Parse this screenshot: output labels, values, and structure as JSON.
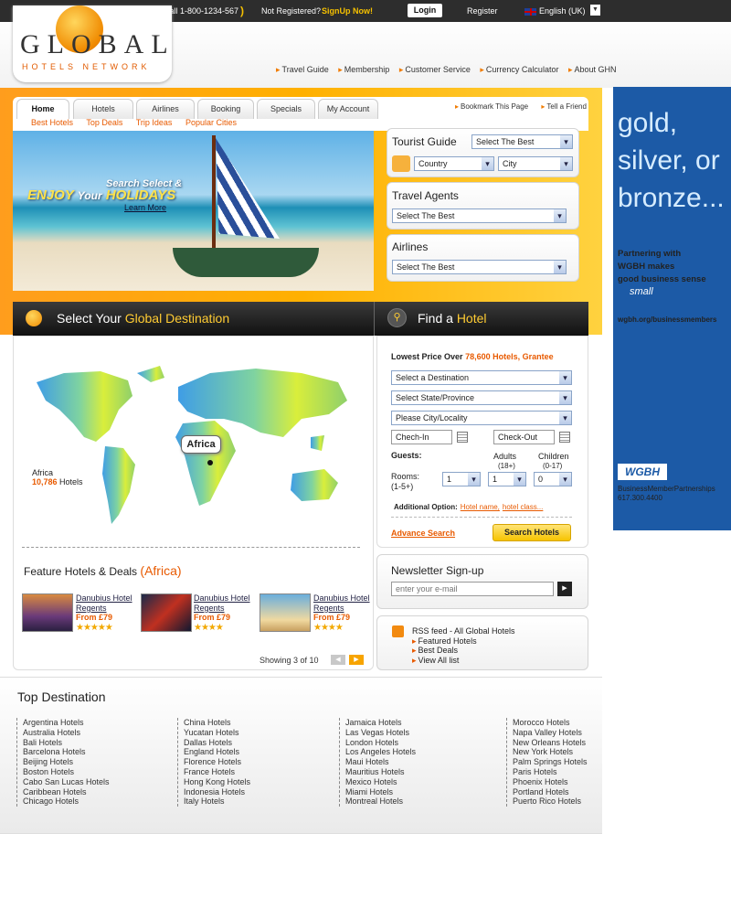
{
  "topbar": {
    "phone": "Call 1-800-1234-567",
    "not_registered": "Not Registered?",
    "signup": "SignUp Now!",
    "login": "Login",
    "register": "Register",
    "language": "English (UK)"
  },
  "logo": {
    "title": "GLOBAL",
    "subtitle": "HOTELS NETWORK"
  },
  "main_nav": [
    "Travel Guide",
    "Membership",
    "Customer Service",
    "Currency Calculator",
    "About GHN"
  ],
  "tabs": [
    {
      "label": "Home",
      "active": true
    },
    {
      "label": "Hotels"
    },
    {
      "label": "Airlines"
    },
    {
      "label": "Booking"
    },
    {
      "label": "Specials"
    },
    {
      "label": "My Account"
    }
  ],
  "subnav": [
    "Best Hotels",
    "Top Deals",
    "Trip Ideas",
    "Popular Cities"
  ],
  "utility_links": [
    "Bookmark This Page",
    "Tell a Friend"
  ],
  "hero": {
    "tagline": "Search Select &",
    "enjoy": "ENJOY",
    "your": "Your",
    "holidays": "HOLIDAYS",
    "learn_more": "Learn More"
  },
  "tourist_guide": {
    "title": "Tourist Guide",
    "select": "Select The Best",
    "country": "Country",
    "city": "City"
  },
  "travel_agents": {
    "title": "Travel Agents",
    "select": "Select The Best"
  },
  "airlines": {
    "title": "Airlines",
    "select": "Select The Best"
  },
  "destination_bar": {
    "prefix": "Select Your",
    "highlight": "Global Destination"
  },
  "find_bar": {
    "prefix": "Find a",
    "highlight": "Hotel"
  },
  "map": {
    "region": "Africa",
    "count": "10,786",
    "suffix": "Hotels",
    "bubble": "Africa"
  },
  "features": {
    "title": "Feature Hotels & Deals",
    "region": "(Africa)",
    "hotels": [
      {
        "name": "Danubius Hotel Regents",
        "price": "From £79",
        "stars": "★★★★★"
      },
      {
        "name": "Danubius Hotel Regents",
        "price": "From £79",
        "stars": "★★★★"
      },
      {
        "name": "Danubius Hotel Regents",
        "price": "From £79",
        "stars": "★★★★"
      }
    ],
    "showing": "Showing 3 of 10"
  },
  "find_hotel": {
    "lowest_prefix": "Lowest Price Over",
    "lowest_value": "78,600 Hotels, Grantee",
    "destination": "Select a Destination",
    "state": "Select State/Province",
    "city": "Please City/Locality",
    "checkin": "Chech-In",
    "checkout": "Check-Out",
    "guests": "Guests:",
    "adults": "Adults",
    "adults_range": "(18+)",
    "children": "Children",
    "children_range": "(0-17)",
    "rooms": "Rooms:",
    "rooms_range": "(1-5+)",
    "rooms_val": "1",
    "adults_val": "1",
    "children_val": "0",
    "additional": "Additional Option:",
    "hotel_name": "Hotel name,",
    "hotel_class": "hotel class...",
    "advance": "Advance Search",
    "search": "Search Hotels"
  },
  "newsletter": {
    "title": "Newsletter Sign-up",
    "placeholder": "enter your e-mail"
  },
  "rss": {
    "title": "RSS feed - All Global Hotels",
    "items": [
      "Featured Hotels",
      "Best Deals",
      "View All list"
    ]
  },
  "ad": {
    "line1": "gold,",
    "line2": "silver, or",
    "line3": "bronze...",
    "partner1": "Partnering with",
    "partner2": "WGBH makes",
    "partner3": "good business sense",
    "small": "small",
    "url": "wgbh.org/businessmembers",
    "logo": "WGBH",
    "bm1": "BusinessMemberPartnerships",
    "phone": "617.300.4400"
  },
  "top_destination": {
    "title": "Top Destination",
    "columns": [
      [
        "Argentina Hotels",
        "Australia Hotels",
        "Bali Hotels",
        "Barcelona Hotels",
        "Beijing Hotels",
        "Boston Hotels",
        "Cabo San Lucas Hotels",
        "Caribbean Hotels",
        "Chicago Hotels"
      ],
      [
        "China Hotels",
        "Yucatan Hotels",
        "Dallas Hotels",
        "England Hotels",
        "Florence Hotels",
        "France Hotels",
        "Hong Kong Hotels",
        "Indonesia Hotels",
        "Italy Hotels"
      ],
      [
        "Jamaica Hotels",
        "Las Vegas Hotels",
        "London Hotels",
        "Los Angeles Hotels",
        "Maui Hotels",
        "Mauritius Hotels",
        "Mexico Hotels",
        "Miami Hotels",
        "Montreal Hotels"
      ],
      [
        "Morocco Hotels",
        "Napa Valley Hotels",
        "New Orleans Hotels",
        "New York Hotels",
        "Palm Springs Hotels",
        "Paris Hotels",
        "Phoenix Hotels",
        "Portland Hotels",
        "Puerto Rico Hotels"
      ]
    ]
  }
}
